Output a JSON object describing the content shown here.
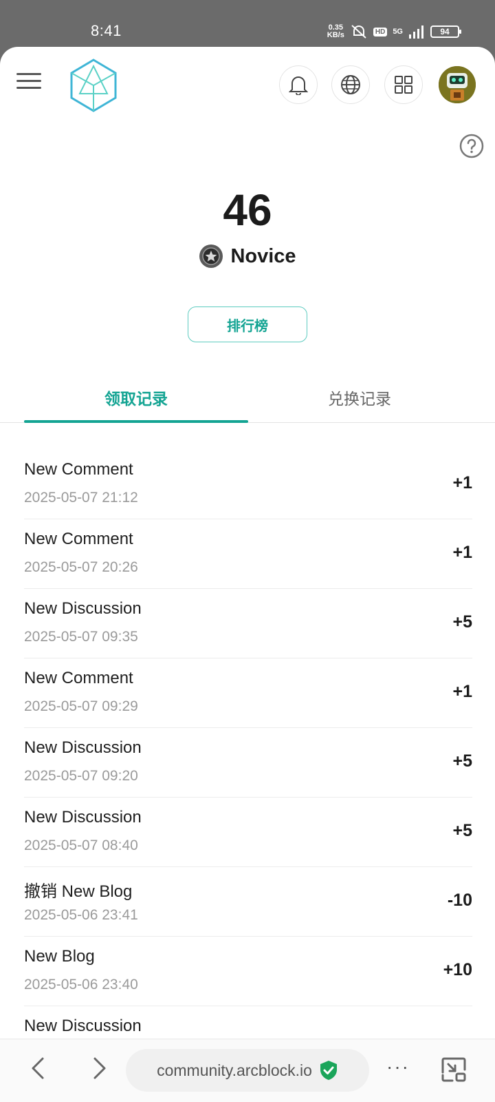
{
  "status_bar": {
    "time": "8:41",
    "net_speed_value": "0.35",
    "net_speed_unit": "KB/s",
    "hd_label": "HD",
    "network": "5G",
    "battery": "94"
  },
  "header": {
    "icons": [
      "menu-icon",
      "arcblock-logo",
      "bell-icon",
      "globe-icon",
      "apps-grid-icon",
      "avatar"
    ]
  },
  "summary": {
    "points": "46",
    "level": "Novice",
    "leaderboard_label": "排行榜"
  },
  "tabs": [
    {
      "label": "领取记录",
      "active": true
    },
    {
      "label": "兑换记录",
      "active": false
    }
  ],
  "records": [
    {
      "title": "New Comment",
      "time": "2025-05-07 21:12",
      "points": "+1"
    },
    {
      "title": "New Comment",
      "time": "2025-05-07 20:26",
      "points": "+1"
    },
    {
      "title": "New Discussion",
      "time": "2025-05-07 09:35",
      "points": "+5"
    },
    {
      "title": "New Comment",
      "time": "2025-05-07 09:29",
      "points": "+1"
    },
    {
      "title": "New Discussion",
      "time": "2025-05-07 09:20",
      "points": "+5"
    },
    {
      "title": "New Discussion",
      "time": "2025-05-07 08:40",
      "points": "+5"
    },
    {
      "title": "撤销 New Blog",
      "time": "2025-05-06 23:41",
      "points": "-10"
    },
    {
      "title": "New Blog",
      "time": "2025-05-06 23:40",
      "points": "+10"
    },
    {
      "title": "New Discussion",
      "time": "",
      "points": ""
    }
  ],
  "browser": {
    "url": "community.arcblock.io",
    "more_label": "···"
  },
  "colors": {
    "accent": "#14a493",
    "text_primary": "#1b1b1b",
    "text_secondary": "#9a9a9a"
  }
}
